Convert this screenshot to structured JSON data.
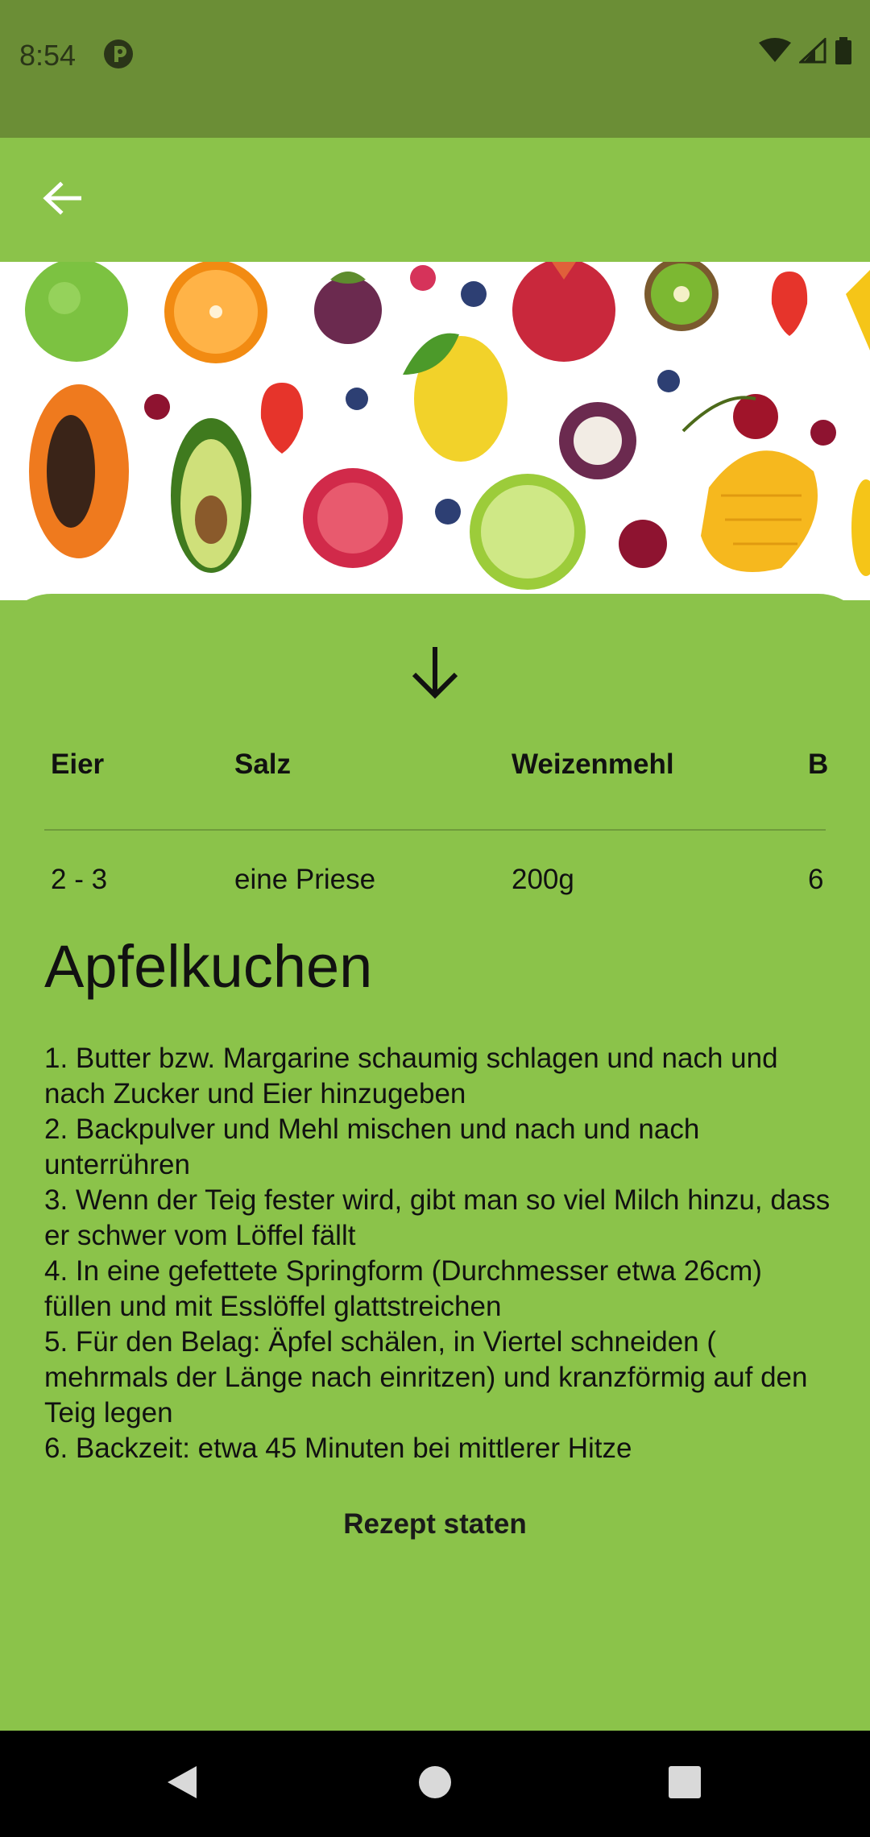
{
  "status_bar": {
    "time": "8:54",
    "icons": [
      "app-notification-icon",
      "wifi-icon",
      "signal-icon",
      "battery-icon"
    ]
  },
  "app_bar": {
    "back_icon": "arrow-left-icon"
  },
  "hero": {
    "image": "fruit-assortment-photo"
  },
  "sheet": {
    "collapse_icon": "arrow-down-icon",
    "ingredients": {
      "headers": [
        "Eier",
        "Salz",
        "Weizenmehl",
        "B"
      ],
      "values": [
        "2 - 3",
        "eine Priese",
        "200g",
        "6"
      ]
    },
    "title": "Apfelkuchen",
    "steps": " 1. Butter bzw. Margarine schaumig schlagen und nach und nach Zucker und Eier hinzugeben\n2. Backpulver und Mehl mischen und nach und nach unterrühren\n3. Wenn der Teig fester wird, gibt man so viel Milch hinzu, dass er schwer vom Löffel fällt\n4. In eine gefettete Springform (Durchmesser etwa 26cm) füllen und mit Esslöffel glattstreichen\n5. Für den Belag: Äpfel schälen, in Viertel schneiden ( mehrmals der Länge nach einritzen) und kranzförmig auf den Teig legen\n6. Backzeit: etwa 45 Minuten bei mittlerer Hitze",
    "start_label": "Rezept staten"
  },
  "nav_bar": {
    "icons": [
      "back-triangle-icon",
      "home-circle-icon",
      "recents-square-icon"
    ]
  },
  "colors": {
    "status_bar": "#6b8e36",
    "app_bar": "#8bc34a",
    "sheet": "#8bc34a",
    "nav_bar": "#000000"
  }
}
